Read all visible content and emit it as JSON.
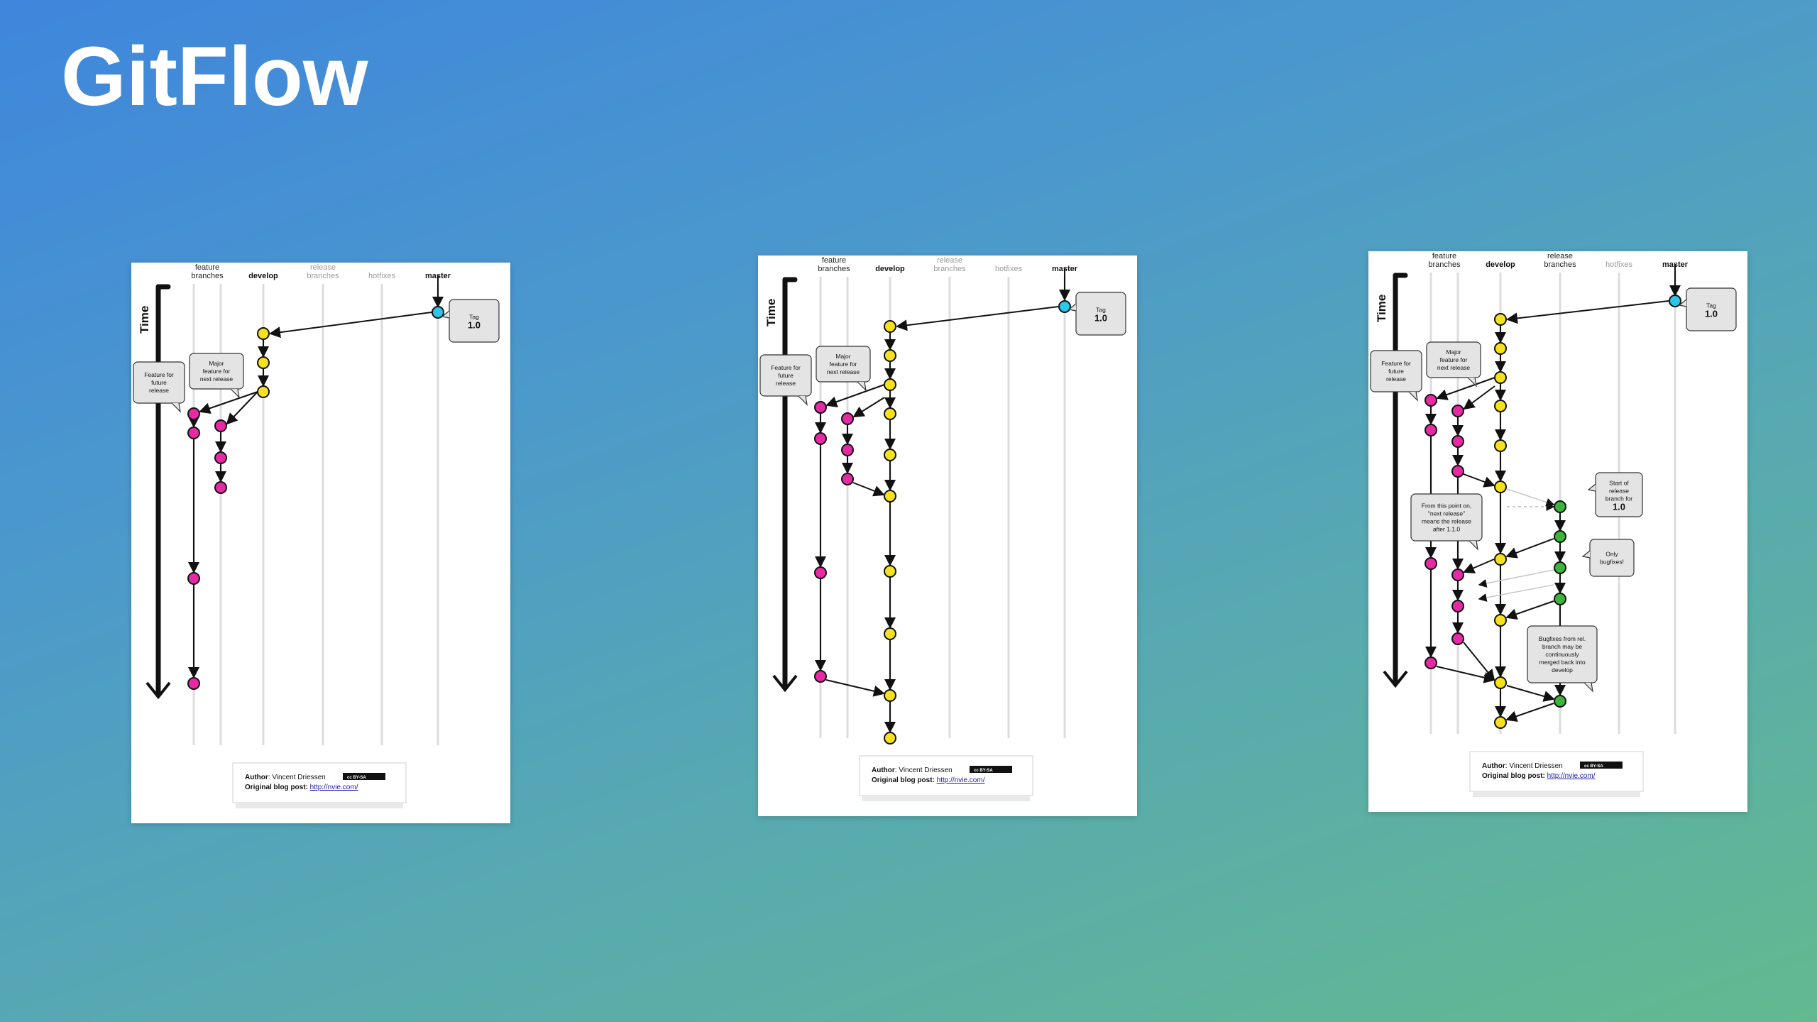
{
  "slide": {
    "title": "GitFlow"
  },
  "colors": {
    "feature": "#e52aa4",
    "develop": "#f5e11c",
    "release": "#3cb43c",
    "master": "#2ec6e8",
    "node_stroke": "#111111",
    "callout_fill": "#e4e4e4"
  },
  "lanes": [
    {
      "key": "feature",
      "label": "feature branches"
    },
    {
      "key": "develop",
      "label": "develop"
    },
    {
      "key": "release",
      "label": "release branches"
    },
    {
      "key": "hotfixes",
      "label": "hotfixes"
    },
    {
      "key": "master",
      "label": "master"
    }
  ],
  "time_label": "Time",
  "footer": {
    "author_label": "Author",
    "author_name": ": Vincent Driessen",
    "blog_label": "Original blog post",
    "blog_url": "http://nvie.com/",
    "license_badge": "cc BY-SA"
  },
  "panels": [
    {
      "callouts": {
        "tag": [
          "Tag",
          "1.0"
        ],
        "future": [
          "Feature for",
          "future",
          "release"
        ],
        "major": [
          "Major",
          "feature for",
          "next release"
        ]
      }
    },
    {
      "callouts": {
        "tag": [
          "Tag",
          "1.0"
        ],
        "future": [
          "Feature for",
          "future",
          "release"
        ],
        "major": [
          "Major",
          "feature for",
          "next release"
        ]
      }
    },
    {
      "callouts": {
        "tag": [
          "Tag",
          "1.0"
        ],
        "future": [
          "Feature for",
          "future",
          "release"
        ],
        "major": [
          "Major",
          "feature for",
          "next release"
        ],
        "start_release": [
          "Start of",
          "release",
          "branch for",
          "1.0"
        ],
        "from_point": [
          "From this point on,",
          "\"next release\"",
          "means the release",
          "after 1.1.0"
        ],
        "only_bugfixes": [
          "Only",
          "bugfixes!"
        ],
        "bugfixes_merged": [
          "Bugfixes from rel.",
          "branch may be",
          "continuously",
          "merged back into",
          "develop"
        ]
      }
    }
  ]
}
